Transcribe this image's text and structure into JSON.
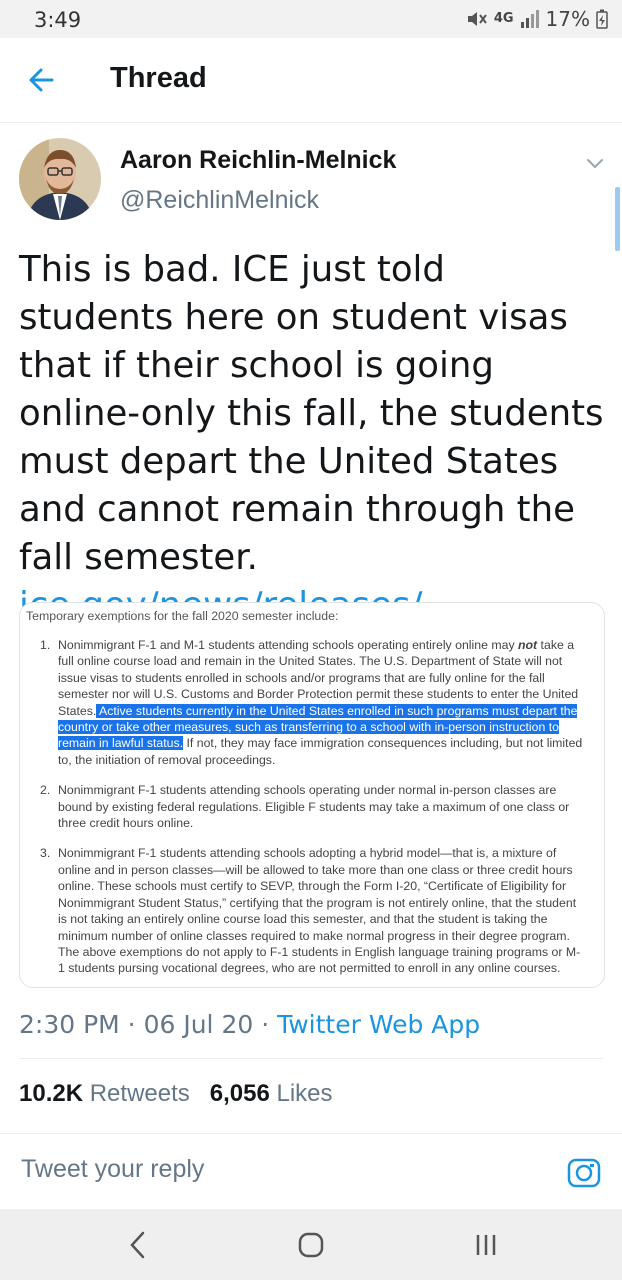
{
  "status_bar": {
    "time": "3:49",
    "network": "4G",
    "battery": "17%"
  },
  "header": {
    "title": "Thread"
  },
  "tweet": {
    "author_name": "Aaron Reichlin-Melnick",
    "author_handle": "@ReichlinMelnick",
    "text": "This is bad. ICE just told students here on student visas that if their school is going online-only this fall, the students must depart the United States and cannot remain through the fall semester.",
    "link": "ice.gov/news/releases/…",
    "timestamp": "2:30 PM · 06 Jul 20 · ",
    "source_app": "Twitter Web App",
    "retweets_count": "10.2K",
    "retweets_label": "Retweets",
    "likes_count": "6,056",
    "likes_label": "Likes"
  },
  "media": {
    "intro": "Temporary exemptions for the fall 2020 semester include:",
    "items": [
      {
        "num": "1.",
        "part1": "Nonimmigrant F-1 and M-1 students attending schools operating entirely online may ",
        "emph": "not",
        "part2": " take a full online course load and remain in the United States. The U.S. Department of State will not issue visas to students enrolled in schools and/or programs that are fully online for the fall semester nor will U.S. Customs and Border Protection permit these students to enter the United States.",
        "highlight": " Active students currently in the United States enrolled in such programs must depart the country or take other measures, such as transferring to a school with in-person instruction to remain in lawful status.",
        "part3": " If not, they may face immigration consequences including, but not limited to, the initiation of removal proceedings."
      },
      {
        "num": "2.",
        "text": "Nonimmigrant F-1 students attending schools operating under normal in-person classes are bound by existing federal regulations. Eligible F students may take a maximum of one class or three credit hours online."
      },
      {
        "num": "3.",
        "text": "Nonimmigrant F-1 students attending schools adopting a hybrid model—that is, a mixture of online and in person classes—will be allowed to take more than one class or three credit hours online. These schools must certify to SEVP, through the Form I-20, “Certificate of Eligibility for Nonimmigrant Student Status,” certifying that the program is not entirely online, that the student is not taking an entirely online course load this semester, and that the student is taking the minimum number of online classes required to make normal progress in their degree program. The above exemptions do not apply to F-1 students in English language training programs or M-1 students pursing vocational degrees, who are not permitted to enroll in any online courses."
      }
    ]
  },
  "reply": {
    "placeholder": "Tweet your reply"
  },
  "colors": {
    "accent": "#1b95e0",
    "secondary_text": "#657786",
    "highlight": "#1a73e8"
  },
  "icons": {
    "back": "arrow-left-icon",
    "caret": "chevron-down-icon",
    "camera": "camera-icon",
    "nav_back": "nav-back-icon",
    "nav_home": "nav-home-icon",
    "nav_recents": "nav-recents-icon"
  }
}
